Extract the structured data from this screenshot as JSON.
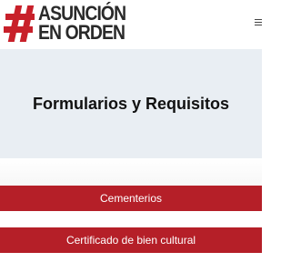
{
  "header": {
    "logo": {
      "line1": "ASUNCIÓN",
      "line2": "EN ORDEN"
    },
    "menu_icon": "hamburger-menu-icon"
  },
  "hero": {
    "title": "Formularios y Requisitos"
  },
  "links": [
    {
      "label": "Cementerios"
    },
    {
      "label": "Certificado de bien cultural"
    }
  ],
  "colors": {
    "brand_red": "#b51f28",
    "hero_bg": "#e9eef3",
    "logo_text": "#2a2a2a"
  }
}
